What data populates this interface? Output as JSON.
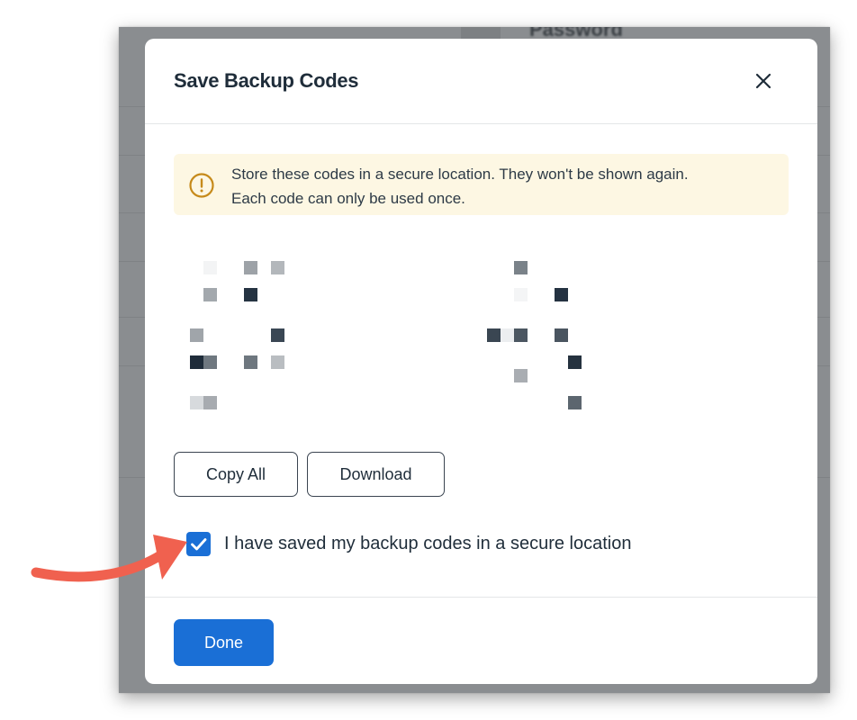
{
  "background_page": {
    "label": "Password"
  },
  "modal": {
    "title": "Save Backup Codes",
    "close_icon": "close-icon",
    "warning": {
      "icon": "alert-circle-icon",
      "line1": "Store these codes in a secure location. They won't be shown again.",
      "line2": "Each code can only be used once."
    },
    "codes_state": "redacted / pixelated",
    "actions": {
      "copy_label": "Copy All",
      "download_label": "Download"
    },
    "confirm": {
      "checked": true,
      "label": "I have saved my backup codes in a secure location"
    },
    "footer": {
      "done_label": "Done"
    }
  },
  "colors": {
    "accent": "#1a6fd6",
    "warning_bg": "#fdf7e3",
    "warning_icon": "#c68a1a",
    "annotation_arrow": "#f0614f",
    "text_primary": "#1f2d3a"
  }
}
